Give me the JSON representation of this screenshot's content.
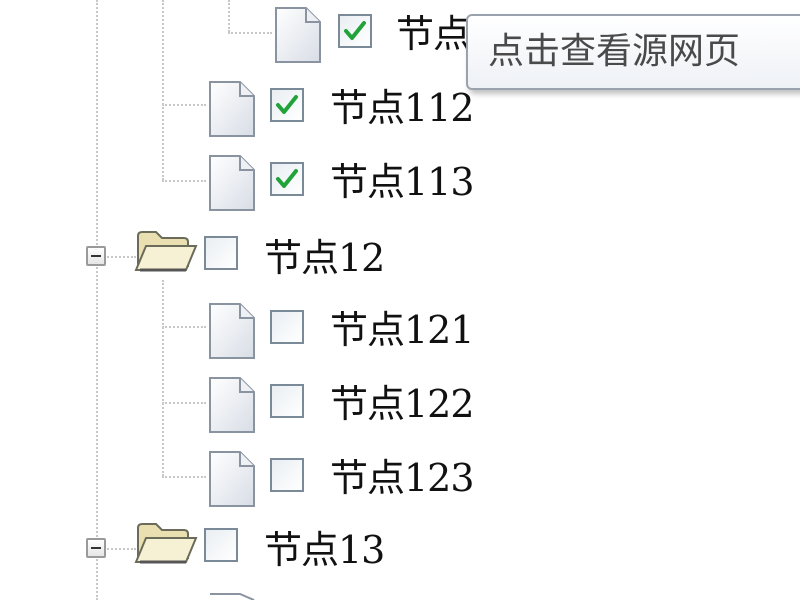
{
  "tree": {
    "nodes": [
      {
        "id": "n111",
        "label": "节点",
        "type": "file",
        "checked": true
      },
      {
        "id": "n112",
        "label": "节点112",
        "type": "file",
        "checked": true
      },
      {
        "id": "n113",
        "label": "节点113",
        "type": "file",
        "checked": true
      },
      {
        "id": "n12",
        "label": "节点12",
        "type": "folder",
        "expanded": true,
        "checked": false
      },
      {
        "id": "n121",
        "label": "节点121",
        "type": "file",
        "checked": false
      },
      {
        "id": "n122",
        "label": "节点122",
        "type": "file",
        "checked": false
      },
      {
        "id": "n123",
        "label": "节点123",
        "type": "file",
        "checked": false
      },
      {
        "id": "n13",
        "label": "节点13",
        "type": "folder",
        "expanded": true,
        "checked": false
      }
    ]
  },
  "tooltip": {
    "text": "点击查看源网页"
  },
  "colors": {
    "check_mark": "#22a33a",
    "folder_fill": "#f3ecc8",
    "connector": "#c8c8c8"
  }
}
